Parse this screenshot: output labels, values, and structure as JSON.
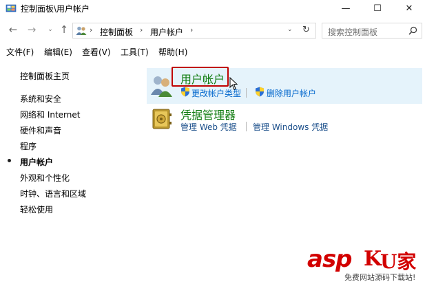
{
  "window": {
    "title": "控制面板\\用户帐户",
    "min_glyph": "—",
    "max_glyph": "☐",
    "close_glyph": "✕"
  },
  "nav": {
    "back": "←",
    "forward": "→",
    "recent": "⌄",
    "up": "↑"
  },
  "address": {
    "crumbs": [
      "控制面板",
      "用户帐户"
    ],
    "sep": "›",
    "dropdown": "⌄",
    "refresh": "↻"
  },
  "search": {
    "placeholder": "搜索控制面板"
  },
  "menu": [
    "文件(F)",
    "编辑(E)",
    "查看(V)",
    "工具(T)",
    "帮助(H)"
  ],
  "leftnav": {
    "home": "控制面板主页",
    "items": [
      "系统和安全",
      "网络和 Internet",
      "硬件和声音",
      "程序",
      "用户帐户",
      "外观和个性化",
      "时钟、语言和区域",
      "轻松使用"
    ],
    "active_index": 4
  },
  "categories": [
    {
      "title": "用户帐户",
      "icon": "user-accounts-icon",
      "links": [
        "更改帐户类型",
        "删除用户帐户"
      ]
    },
    {
      "title": "凭据管理器",
      "icon": "credential-manager-icon",
      "links": [
        "管理 Web 凭据",
        "管理 Windows 凭据"
      ]
    }
  ],
  "watermark": {
    "asp": "asp",
    "k": "K",
    "cn": "U家",
    "sub": "免费网站源码下载站!"
  },
  "colors": {
    "green_title": "#107c10",
    "link": "#0066cc",
    "highlight_bg": "#e5f3fb",
    "red_box": "#c00000",
    "watermark": "#d20000"
  }
}
